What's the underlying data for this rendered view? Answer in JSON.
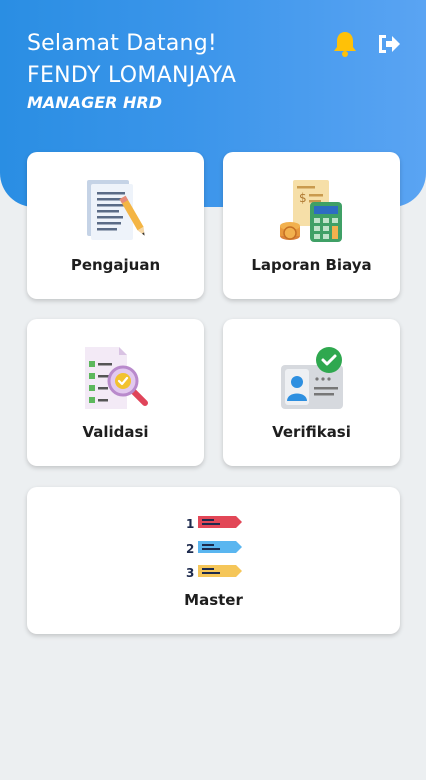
{
  "header": {
    "greeting": "Selamat Datang!",
    "user_name": "FENDY LOMANJAYA",
    "role": "MANAGER HRD",
    "bell_icon": "bell-icon",
    "logout_icon": "logout-icon"
  },
  "menu": {
    "items": [
      {
        "label": "Pengajuan",
        "icon": "document-pencil-icon"
      },
      {
        "label": "Laporan Biaya",
        "icon": "calculator-invoice-icon"
      },
      {
        "label": "Validasi",
        "icon": "checklist-magnifier-icon"
      },
      {
        "label": "Verifikasi",
        "icon": "id-card-check-icon"
      },
      {
        "label": "Master",
        "icon": "numbered-list-icon"
      }
    ]
  },
  "colors": {
    "header_start": "#2a8ee3",
    "header_end": "#5aa4f3",
    "background": "#eceff1",
    "bell": "#ffc107"
  }
}
